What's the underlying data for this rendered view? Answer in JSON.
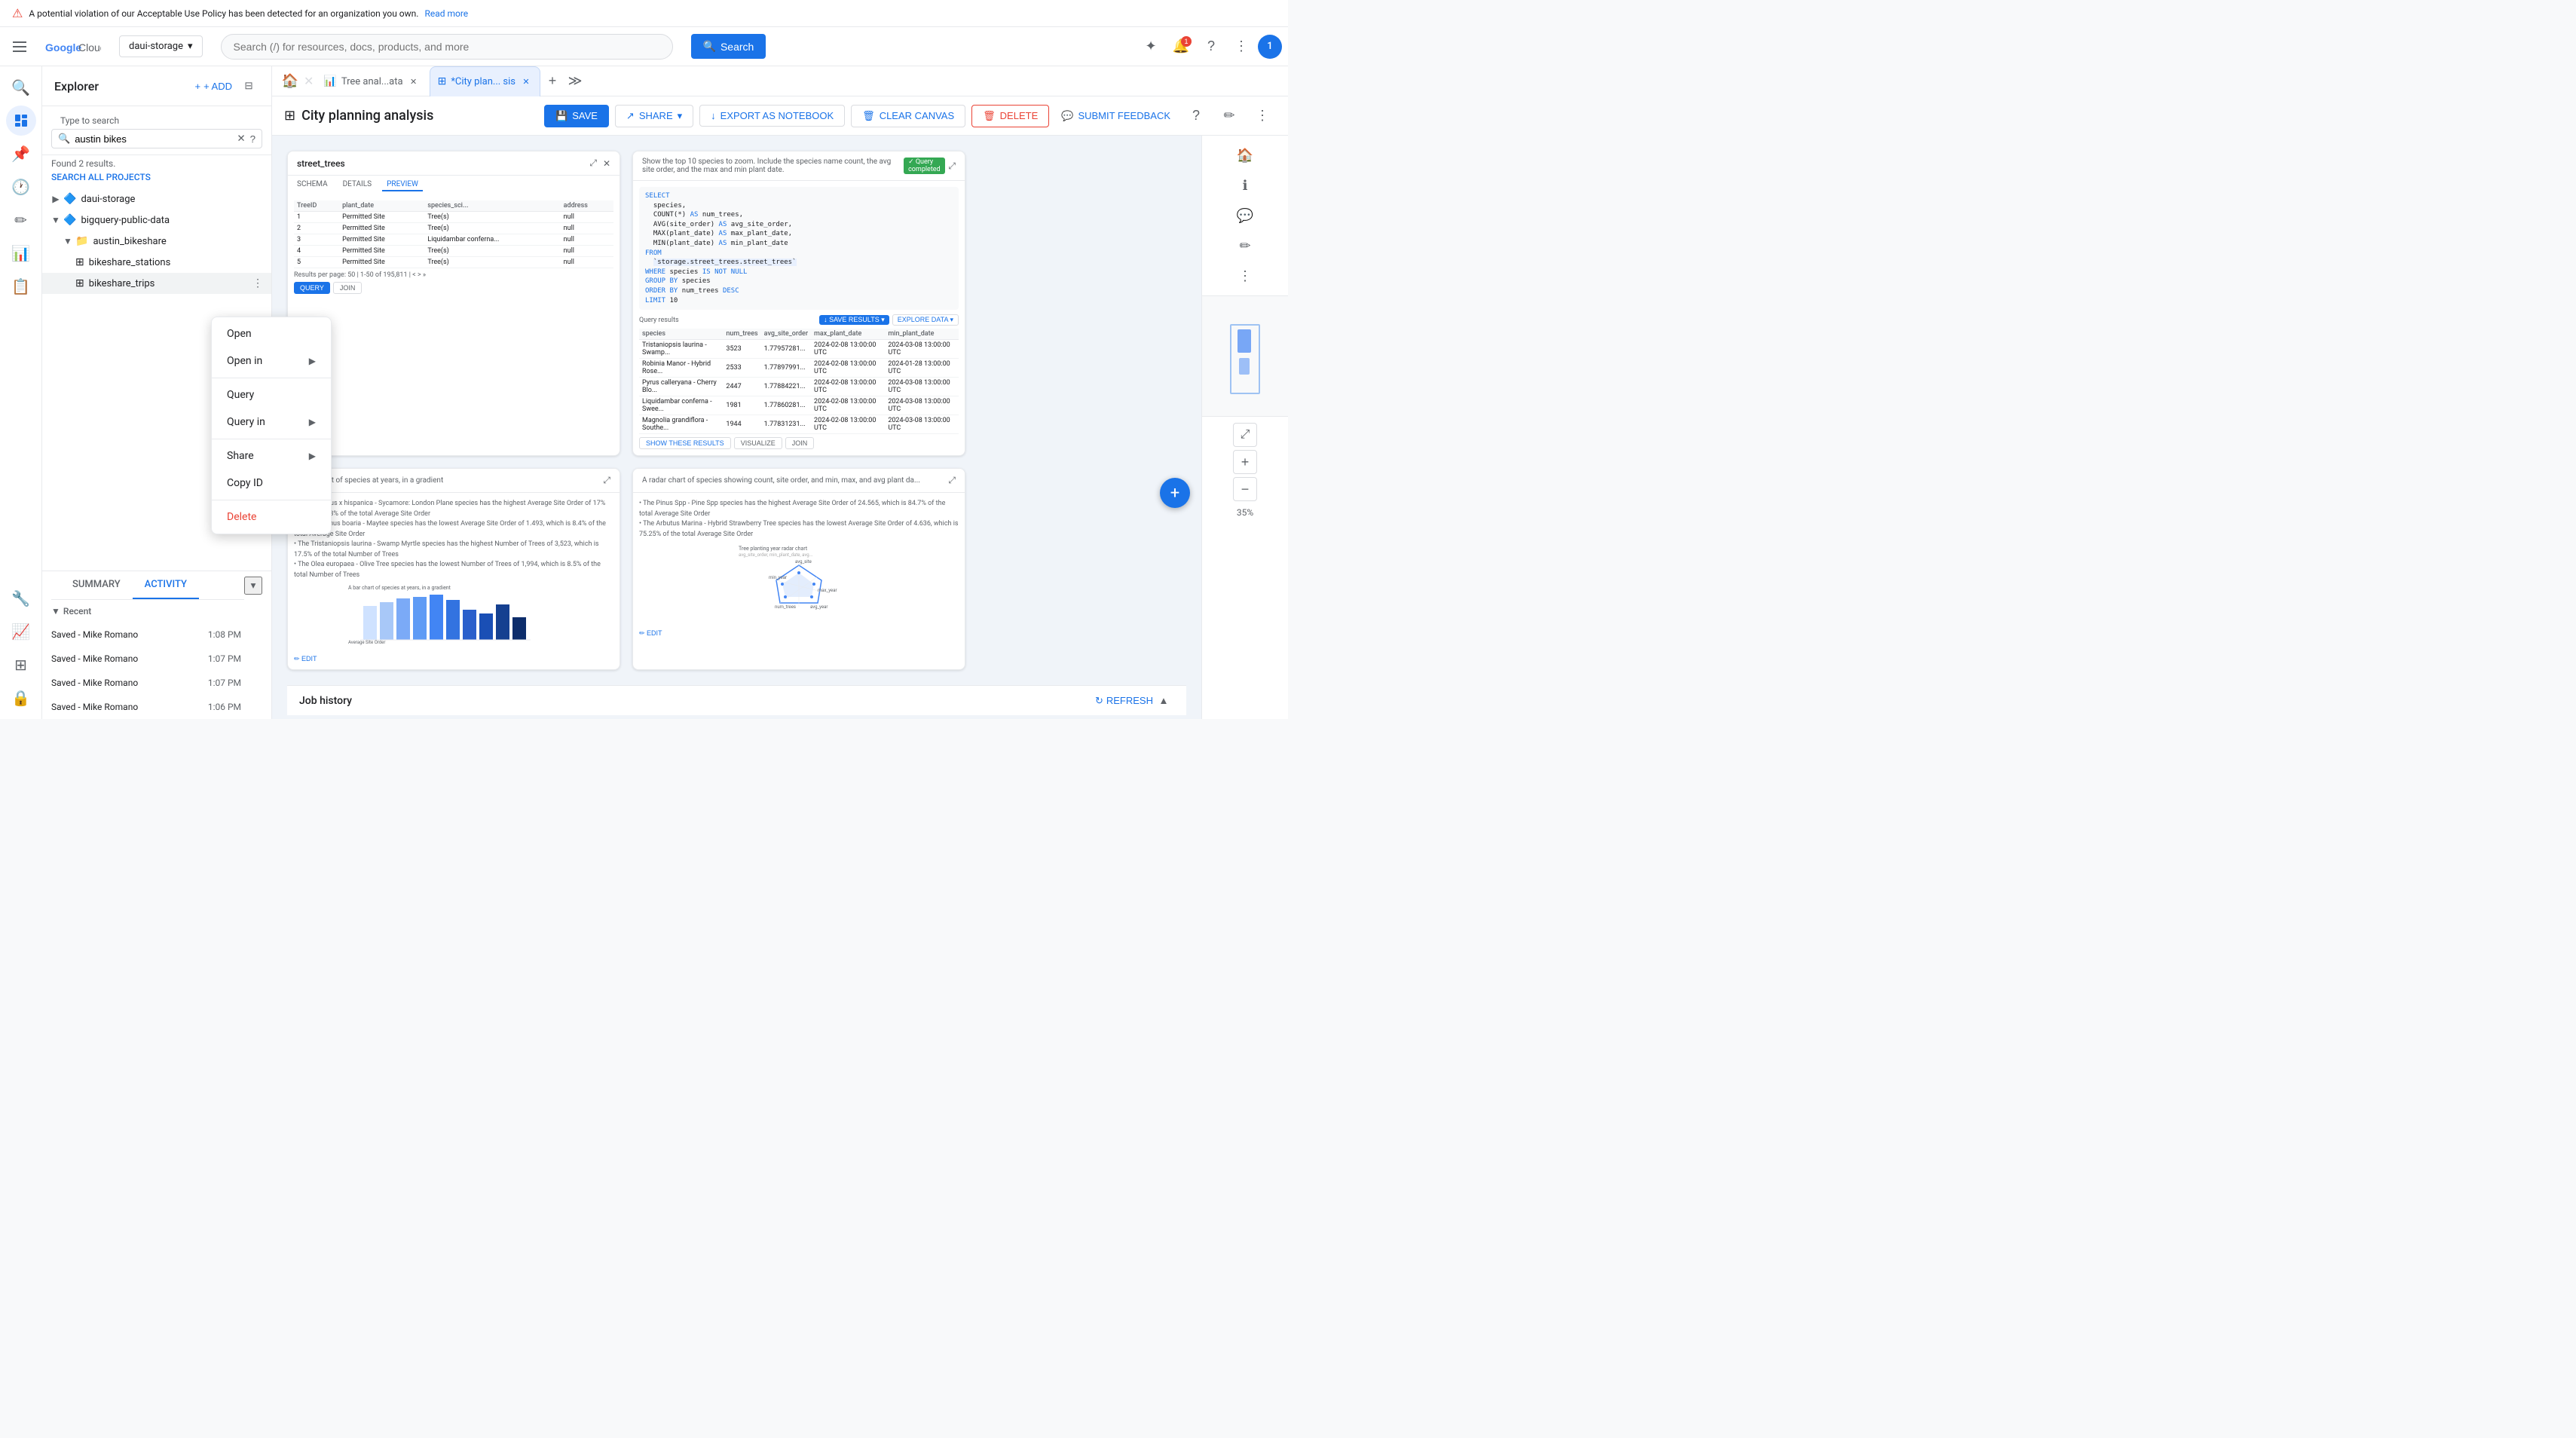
{
  "warning": {
    "text": "A potential violation of our Acceptable Use Policy has been detected for an organization you own.",
    "link_text": "Read more"
  },
  "topnav": {
    "project": "daui-storage",
    "search_placeholder": "Search (/) for resources, docs, products, and more",
    "search_label": "Search",
    "user_initial": "1",
    "notification_count": "1"
  },
  "explorer": {
    "title": "Explorer",
    "add_label": "+ ADD",
    "search_placeholder": "Type to search",
    "search_value": "austin bikes",
    "results_text": "Found 2 results.",
    "search_all_label": "SEARCH ALL PROJECTS",
    "projects": [
      {
        "name": "daui-storage",
        "datasets": []
      },
      {
        "name": "bigquery-public-data",
        "datasets": [
          {
            "name": "austin_bikeshare",
            "tables": [
              {
                "name": "bikeshare_stations",
                "active": false
              },
              {
                "name": "bikeshare_trips",
                "active": true
              }
            ]
          }
        ]
      }
    ]
  },
  "tabs": [
    {
      "id": "home",
      "type": "home",
      "label": ""
    },
    {
      "id": "tree",
      "label": "Tree anal...ata",
      "closeable": true
    },
    {
      "id": "city",
      "label": "*City plan... sis",
      "closeable": true,
      "active": true
    }
  ],
  "toolbar": {
    "title": "City planning analysis",
    "save_label": "SAVE",
    "share_label": "SHARE",
    "export_label": "EXPORT AS NOTEBOOK",
    "clear_label": "CLEAR CANVAS",
    "delete_label": "DELETE",
    "submit_label": "SUBMIT FEEDBACK"
  },
  "context_menu": {
    "items": [
      {
        "label": "Open",
        "has_arrow": false
      },
      {
        "label": "Open in",
        "has_arrow": true
      },
      {
        "label": "Query",
        "has_arrow": false
      },
      {
        "label": "Query in",
        "has_arrow": true
      },
      {
        "label": "Share",
        "has_arrow": true
      },
      {
        "label": "Copy ID",
        "has_arrow": false
      },
      {
        "label": "Delete",
        "has_arrow": false
      }
    ]
  },
  "canvas": {
    "card1": {
      "title": "street_trees",
      "tabs": [
        "SCHEMA",
        "DETAILS",
        "PREVIEW"
      ],
      "active_tab": "PREVIEW"
    },
    "card2": {
      "sql_text": "Show the top 10 species to zoom. Include the species name count, the avg site order, and the max and min plant date.",
      "badge": "Query completed"
    },
    "card3": {
      "title": "A bar chart of species at years, in a gradient"
    },
    "card4": {
      "title": "A radar chart of species showing count, site order, and min, max, and avg plant da..."
    }
  },
  "bottom_panel": {
    "tabs": [
      "SUMMARY",
      "ACTIVITY"
    ],
    "active_tab": "ACTIVITY",
    "recent_header": "Recent",
    "items": [
      {
        "name": "Saved - Mike Romano",
        "time": "1:08 PM"
      },
      {
        "name": "Saved - Mike Romano",
        "time": "1:07 PM"
      },
      {
        "name": "Saved - Mike Romano",
        "time": "1:07 PM"
      },
      {
        "name": "Saved - Mike Romano",
        "time": "1:06 PM"
      }
    ]
  },
  "job_history": {
    "label": "Job history",
    "refresh_label": "REFRESH"
  },
  "zoom": {
    "level": "35%"
  }
}
